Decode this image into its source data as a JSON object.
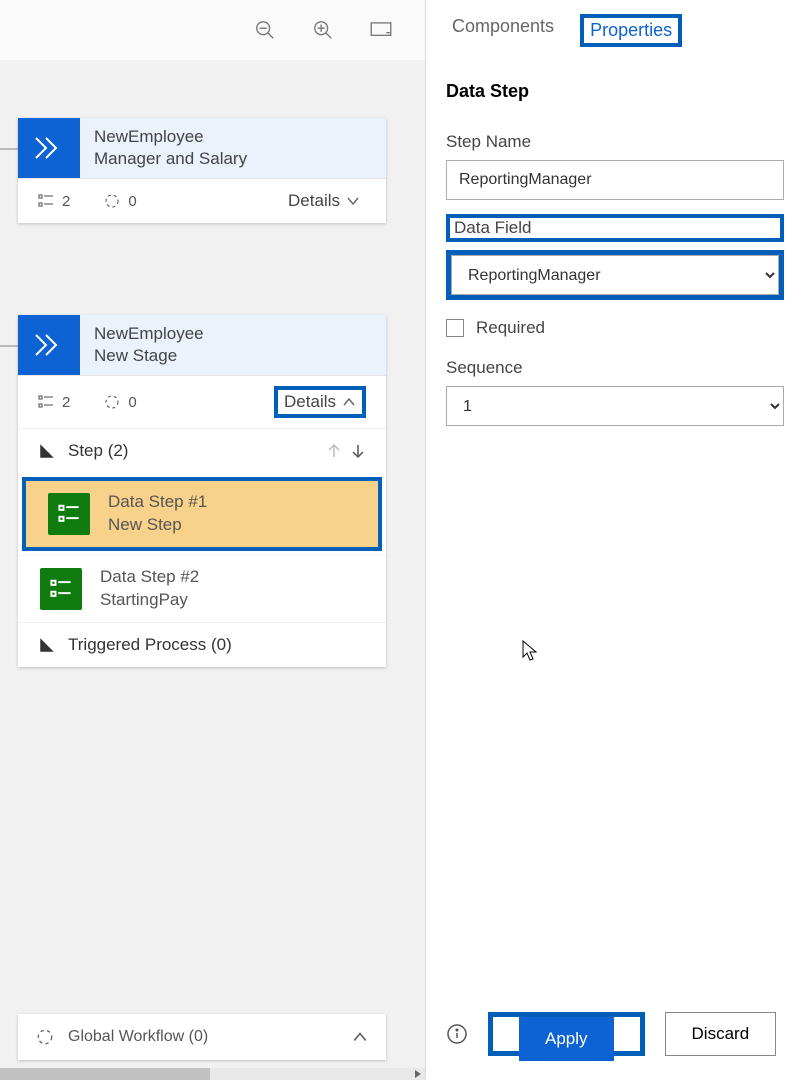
{
  "tabs": {
    "components": "Components",
    "properties": "Properties"
  },
  "prop": {
    "section_title": "Data Step",
    "step_name_label": "Step Name",
    "step_name_value": "ReportingManager",
    "data_field_label": "Data Field",
    "data_field_value": "ReportingManager",
    "required_label": "Required",
    "sequence_label": "Sequence",
    "sequence_value": "1",
    "apply": "Apply",
    "discard": "Discard"
  },
  "stages": [
    {
      "entity": "NewEmployee",
      "name": "Manager and Salary",
      "step_count": "2",
      "wait_count": "0",
      "details": "Details"
    },
    {
      "entity": "NewEmployee",
      "name": "New Stage",
      "step_count": "2",
      "wait_count": "0",
      "details": "Details",
      "steps_header": "Step (2)",
      "steps": [
        {
          "title": "Data Step #1",
          "sub": "New Step"
        },
        {
          "title": "Data Step #2",
          "sub": "StartingPay"
        }
      ],
      "triggered": "Triggered Process (0)"
    }
  ],
  "global_wf": "Global Workflow (0)"
}
